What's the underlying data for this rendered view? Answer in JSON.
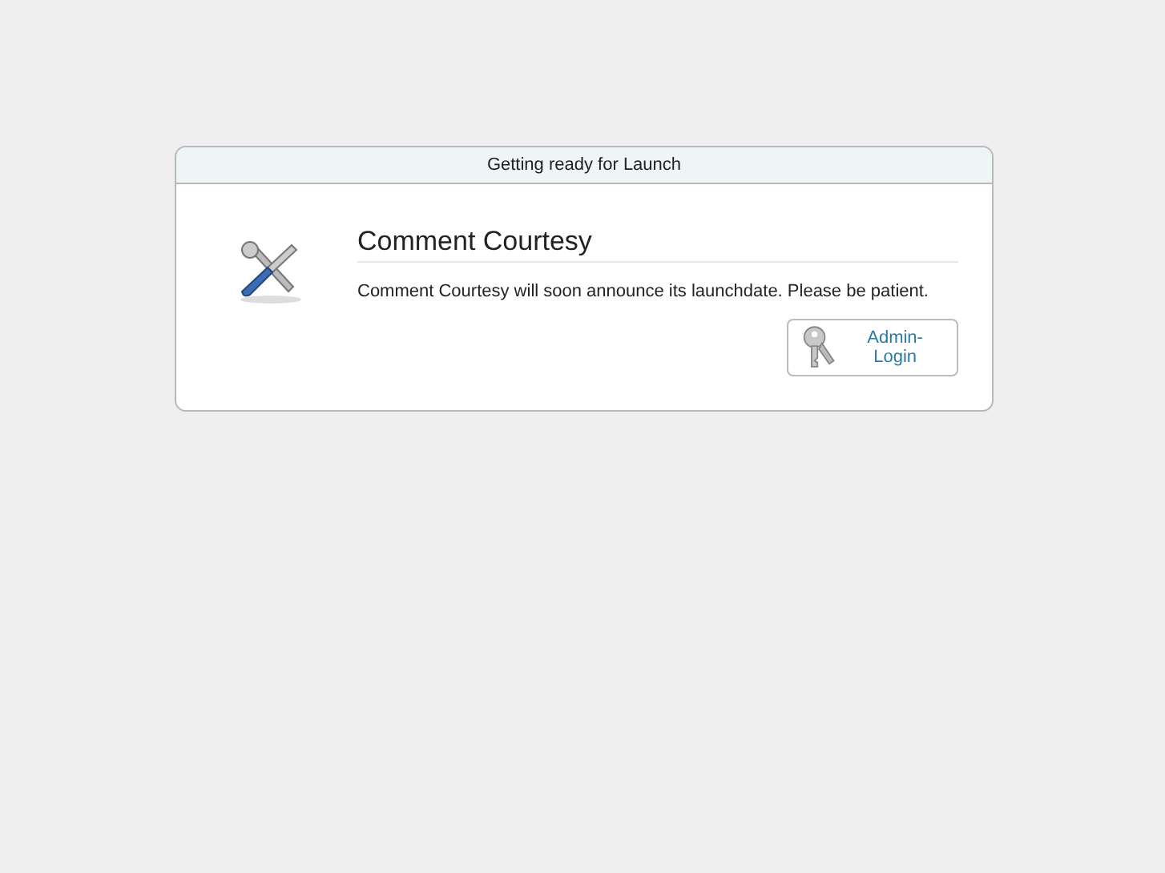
{
  "panel": {
    "header": "Getting ready for Launch",
    "title": "Comment Courtesy",
    "message": "Comment Courtesy will soon announce its launchdate. Please be patient.",
    "button": "Admin-Login"
  }
}
